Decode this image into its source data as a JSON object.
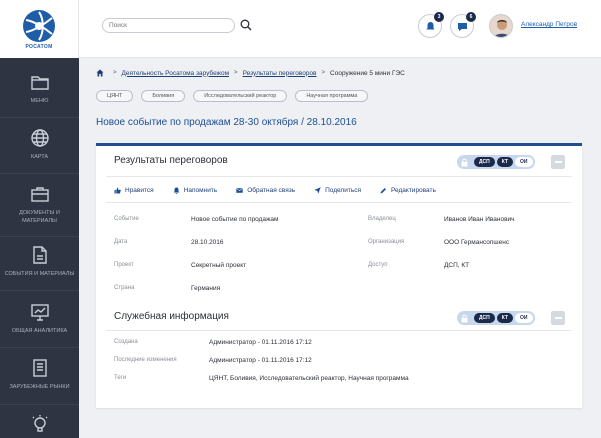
{
  "logo": {
    "text": "РОСАТОМ"
  },
  "sidebar": {
    "items": [
      {
        "label": "МЕНЮ",
        "icon": "folder-icon"
      },
      {
        "label": "КАРТА",
        "icon": "globe-icon"
      },
      {
        "label": "ДОКУМЕНТЫ И МАТЕРИАЛЫ",
        "icon": "briefcase-icon"
      },
      {
        "label": "СОБЫТИЯ И МАТЕРИАЛЫ",
        "icon": "document-icon"
      },
      {
        "label": "ОБЩАЯ АНАЛИТИКА",
        "icon": "monitor-icon"
      },
      {
        "label": "ЗАРУБЕЖНЫЕ РЫНКИ",
        "icon": "book-icon"
      },
      {
        "label": "",
        "icon": "lightbulb-icon"
      }
    ]
  },
  "header": {
    "search_placeholder": "Поиск",
    "notifications_count": "3",
    "messages_count": "6",
    "user_name": "Александр Петров"
  },
  "breadcrumb": {
    "items": [
      "Деятельность Росатома зарубежом",
      "Результаты переговоров",
      "Сооружение 5 мини ГЭС"
    ],
    "separator": ">"
  },
  "tags": [
    "ЦЯНТ",
    "Боливия",
    "Исследовательский реактор",
    "Научная программа"
  ],
  "page_title": "Новое событие по продажам 28-30 октября / 28.10.2016",
  "section1": {
    "title": "Результаты переговоров",
    "access": [
      "ДСП",
      "КТ",
      "ОИ"
    ],
    "actions": [
      "Нравится",
      "Напомнить",
      "Обратная связь",
      "Поделиться",
      "Редактировать"
    ],
    "fields": {
      "event_label": "Событие",
      "event_value": "Новое событие по продажам",
      "date_label": "Дата",
      "date_value": "28.10.2016",
      "project_label": "Проект",
      "project_value": "Секретный проект",
      "country_label": "Страна",
      "country_value": "Германия",
      "owner_label": "Владелец",
      "owner_value": "Иванов Иван Иванович",
      "org_label": "Организация",
      "org_value": "ООО Германсопшенс",
      "access_label": "Доступ",
      "access_value": "ДСП, КТ"
    }
  },
  "section2": {
    "title": "Служебная информация",
    "access": [
      "ДСП",
      "КТ",
      "ОИ"
    ],
    "fields": {
      "created_label": "Создана",
      "created_value": "Администратор - 01.11.2016 17:12",
      "modified_label": "Последние изменения",
      "modified_value": "Администратор - 01.11.2016 17:12",
      "tags_label": "Теги",
      "tags_value": "ЦЯНТ, Боливия, Исследовательский реактор, Научная программа"
    }
  },
  "colors": {
    "accent": "#1e4f96",
    "sidebar": "#2f3442",
    "badge": "#1b2a4a"
  }
}
